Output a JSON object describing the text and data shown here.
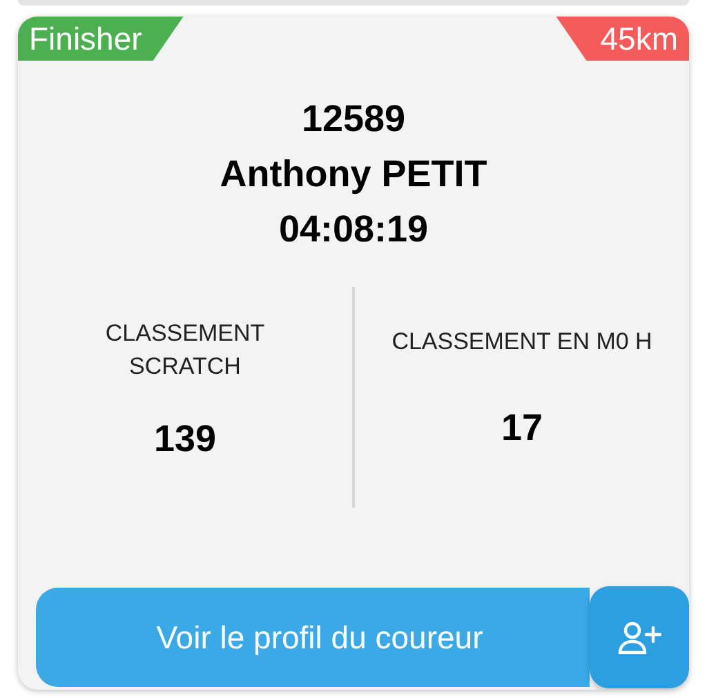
{
  "badges": [
    {
      "kind": "status",
      "label": "Finisher"
    },
    {
      "kind": "distance",
      "label": "45km"
    }
  ],
  "runner": {
    "bib": "12589",
    "name": "Anthony PETIT",
    "time": "04:08:19"
  },
  "rankings": [
    {
      "label": "CLASSEMENT SCRATCH",
      "value": "139"
    },
    {
      "label": "CLASSEMENT EN M0 H",
      "value": "17"
    }
  ],
  "profile_button": {
    "label": "Voir le profil du coureur"
  }
}
